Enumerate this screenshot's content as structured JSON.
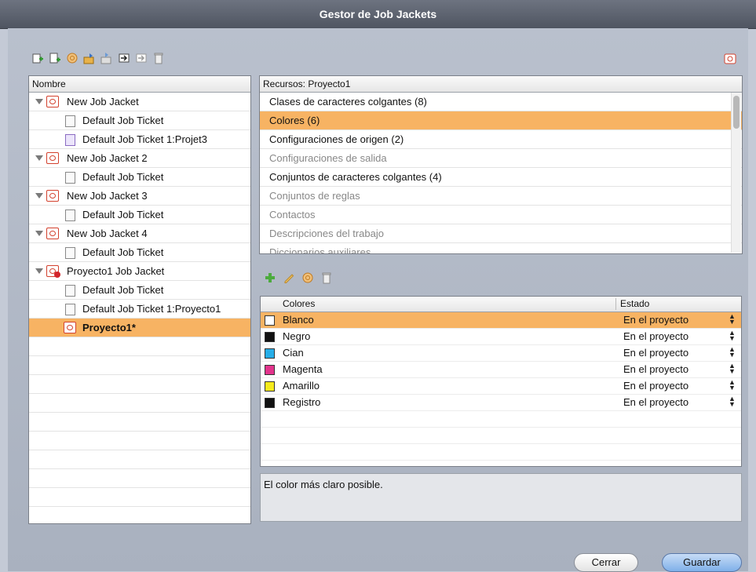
{
  "window": {
    "title": "Gestor de Job Jackets"
  },
  "toolbar": {
    "icons": [
      "new-job-jacket-icon",
      "new-job-ticket-icon",
      "edit-icon",
      "import-icon",
      "export-icon",
      "link-icon",
      "unlink-icon",
      "trash-icon"
    ]
  },
  "tree": {
    "header": "Nombre",
    "items": [
      {
        "label": "New Job Jacket",
        "type": "jacket"
      },
      {
        "label": "Default Job Ticket",
        "type": "ticket"
      },
      {
        "label": "Default Job Ticket 1:Projet3",
        "type": "ticket-purple"
      },
      {
        "label": "New Job Jacket 2",
        "type": "jacket"
      },
      {
        "label": "Default Job Ticket",
        "type": "ticket"
      },
      {
        "label": "New Job Jacket 3",
        "type": "jacket"
      },
      {
        "label": "Default Job Ticket",
        "type": "ticket"
      },
      {
        "label": "New Job Jacket 4",
        "type": "jacket"
      },
      {
        "label": "Default Job Ticket",
        "type": "ticket"
      },
      {
        "label": "Proyecto1 Job Jacket",
        "type": "jacket-warn"
      },
      {
        "label": "Default Job Ticket",
        "type": "ticket"
      },
      {
        "label": "Default Job Ticket 1:Proyecto1",
        "type": "ticket-linked"
      },
      {
        "label": "Proyecto1*",
        "type": "project"
      }
    ]
  },
  "resources": {
    "header": "Recursos: Proyecto1",
    "items": [
      {
        "label": "Clases de caracteres colgantes (8)",
        "dim": false
      },
      {
        "label": "Colores (6)",
        "dim": false
      },
      {
        "label": "Configuraciones de origen (2)",
        "dim": false
      },
      {
        "label": "Configuraciones de salida",
        "dim": true
      },
      {
        "label": "Conjuntos de caracteres colgantes (4)",
        "dim": false
      },
      {
        "label": "Conjuntos de reglas",
        "dim": true
      },
      {
        "label": "Contactos",
        "dim": true
      },
      {
        "label": "Descripciones del trabajo",
        "dim": true
      },
      {
        "label": "Diccionarios auxiliares",
        "dim": true
      }
    ]
  },
  "colors_table": {
    "col_name": "Colores",
    "col_state": "Estado",
    "rows": [
      {
        "name": "Blanco",
        "state": "En el proyecto",
        "swatch": "#ffffff"
      },
      {
        "name": "Negro",
        "state": "En el proyecto",
        "swatch": "#111111"
      },
      {
        "name": "Cian",
        "state": "En el proyecto",
        "swatch": "#27aee8"
      },
      {
        "name": "Magenta",
        "state": "En el proyecto",
        "swatch": "#e2338c"
      },
      {
        "name": "Amarillo",
        "state": "En el proyecto",
        "swatch": "#f5ea1c"
      },
      {
        "name": "Registro",
        "state": "En el proyecto",
        "swatch": "#111111"
      }
    ]
  },
  "description": "El color más claro posible.",
  "buttons": {
    "close": "Cerrar",
    "save": "Guardar"
  },
  "colors": {
    "selection": "#f7b363",
    "default_button": "#7fb0e9"
  }
}
